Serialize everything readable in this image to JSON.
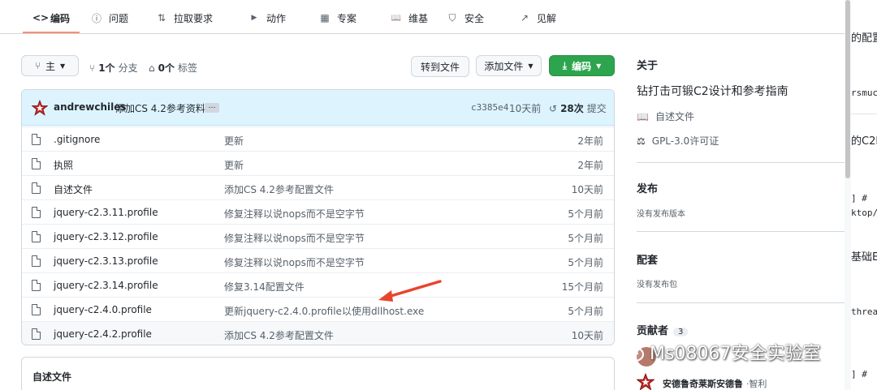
{
  "nav": {
    "tabs": [
      {
        "icon": "<>",
        "label": "编码"
      },
      {
        "icon": "ⓘ",
        "label": "问题"
      },
      {
        "icon": "⇅",
        "label": "拉取要求"
      },
      {
        "icon": "▶",
        "label": "动作"
      },
      {
        "icon": "▦",
        "label": "专案"
      },
      {
        "icon": "📖",
        "label": "维基"
      },
      {
        "icon": "⛉",
        "label": "安全"
      },
      {
        "icon": "↗",
        "label": "见解"
      }
    ]
  },
  "toolbar": {
    "branch": "主",
    "branch_count": "1个",
    "branch_label": "分支",
    "tag_count": "0个",
    "tag_label": "标签",
    "goto_file": "转到文件",
    "add_file": "添加文件",
    "code": "编码"
  },
  "commit": {
    "author": "andrewchiles",
    "message": "添加CS 4.2参考资料",
    "ellipsis": "…",
    "sha": "c3385e4",
    "time": "10天前",
    "count": "28次",
    "count_label": "提交"
  },
  "files": [
    {
      "name": ".gitignore",
      "message": "更新",
      "age": "2年前"
    },
    {
      "name": "执照",
      "message": "更新",
      "age": "2年前"
    },
    {
      "name": "自述文件",
      "message": "添加CS 4.2参考配置文件",
      "age": "10天前"
    },
    {
      "name": "jquery-c2.3.11.profile",
      "message": "修复注释以说nops而不是空字节",
      "age": "5个月前"
    },
    {
      "name": "jquery-c2.3.12.profile",
      "message": "修复注释以说nops而不是空字节",
      "age": "5个月前"
    },
    {
      "name": "jquery-c2.3.13.profile",
      "message": "修复注释以说nops而不是空字节",
      "age": "5个月前"
    },
    {
      "name": "jquery-c2.3.14.profile",
      "message": "修复3.14配置文件",
      "age": "15个月前"
    },
    {
      "name": "jquery-c2.4.0.profile",
      "message": "更新jquery-c2.4.0.profile以使用dllhost.exe",
      "age": "5个月前"
    },
    {
      "name": "jquery-c2.4.2.profile",
      "message": "添加CS 4.2参考配置文件",
      "age": "10天前"
    }
  ],
  "readme": {
    "title": "自述文件"
  },
  "sidebar": {
    "about_title": "关于",
    "description": "钻打击可锻C2设计和参考指南",
    "readme_link": "自述文件",
    "license_link": "GPL-3.0许可证",
    "releases_title": "发布",
    "releases_empty": "没有发布版本",
    "packages_title": "配套",
    "packages_empty": "没有发布包",
    "contributors_title": "贡献者",
    "contributors_count": "3",
    "contributor_name": "安德鲁奇莱斯安德鲁",
    "contributor_extra": "·智利"
  },
  "watermark": "Ms08067安全实验室",
  "right_strip": [
    "的配置",
    "rsmuc",
    "的C2li",
    "]   #",
    "ktop/",
    "基础E",
    "threa",
    "]   #"
  ],
  "colors": {
    "accent": "#fd8c73",
    "green": "#2da44e",
    "commit_bg": "#ddf4ff",
    "arrow": "#e8452c"
  }
}
